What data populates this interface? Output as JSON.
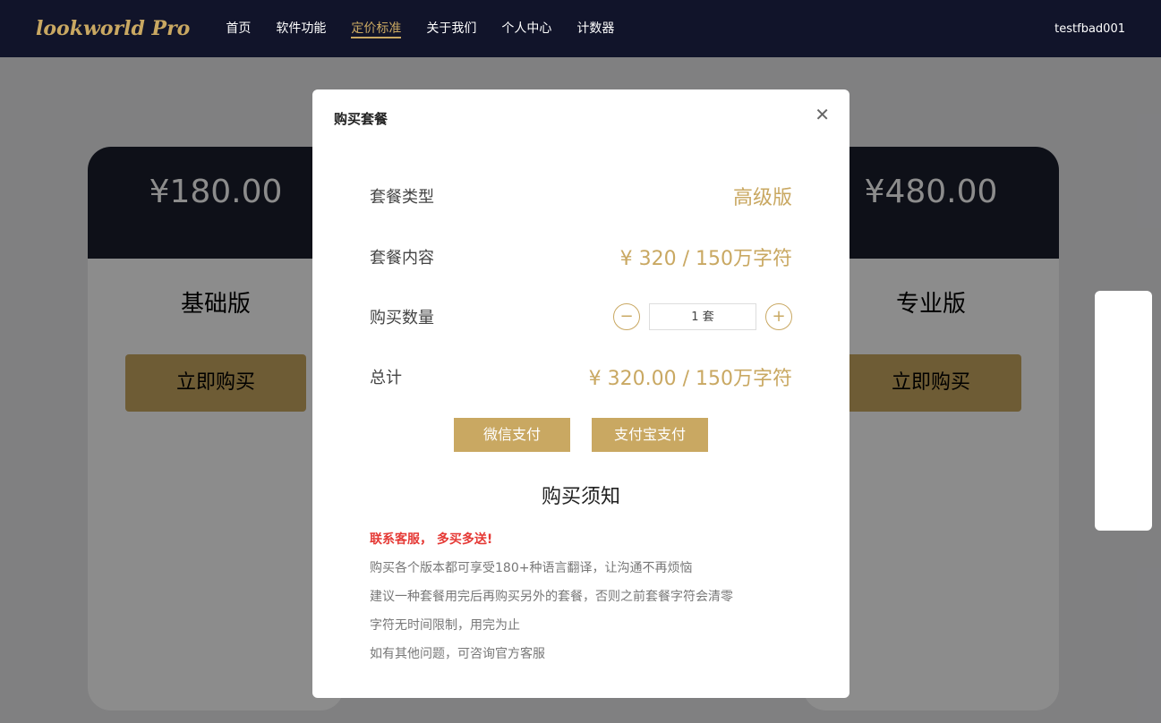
{
  "brand": "lookworld Pro",
  "nav": [
    "首页",
    "软件功能",
    "定价标准",
    "关于我们",
    "个人中心",
    "计数器"
  ],
  "user": "testfbad001",
  "plans": [
    {
      "price": "¥180.00",
      "name": "基础版"
    },
    {
      "price": "¥480.00",
      "name": "专业版"
    }
  ],
  "buy": "立即购买",
  "modal": {
    "title": "购买套餐",
    "type_label": "套餐类型",
    "type_value": "高级版",
    "content_label": "套餐内容",
    "content_value": "¥ 320 / 150万字符",
    "qty_label": "购买数量",
    "qty": "1",
    "unit": "套",
    "total_label": "总计",
    "total_value": "¥ 320.00 / 150万字符",
    "wechat": "微信支付",
    "alipay": "支付宝支付",
    "notice_title": "购买须知",
    "tips": [
      "联系客服， 多买多送!",
      "购买各个版本都可享受180+种语言翻译，让沟通不再烦恼",
      "建议一种套餐用完后再购买另外的套餐，否则之前套餐字符会清零",
      "字符无时间限制，用完为止",
      "如有其他问题，可咨询官方客服"
    ]
  }
}
